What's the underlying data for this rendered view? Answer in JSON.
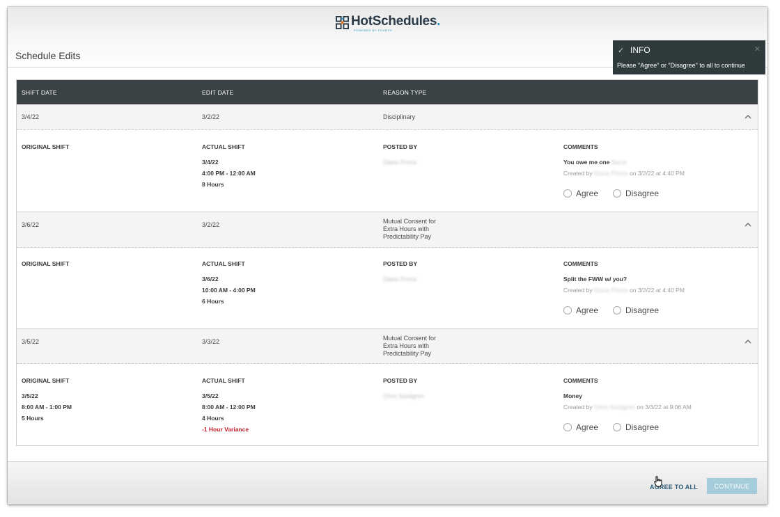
{
  "app": {
    "logo_text": "HotSchedules",
    "logo_dot": ".",
    "logo_sub": "POWERED BY FOURTH",
    "page_title": "Schedule Edits"
  },
  "toast": {
    "title": "INFO",
    "message": "Please \"Agree\" or \"Disagree\" to all to continue"
  },
  "table": {
    "headers": [
      "SHIFT DATE",
      "EDIT DATE",
      "REASON TYPE"
    ],
    "detail_labels": {
      "original": "ORIGINAL SHIFT",
      "actual": "ACTUAL SHIFT",
      "posted": "POSTED BY",
      "comments": "COMMENTS"
    },
    "radio_labels": {
      "agree": "Agree",
      "disagree": "Disagree"
    },
    "edits": [
      {
        "shift_date": "3/4/22",
        "edit_date": "3/2/22",
        "reason": [
          "Disciplinary"
        ],
        "original": [],
        "actual": [
          "3/4/22",
          "4:00 PM - 12:00 AM",
          "8 Hours"
        ],
        "variance": "",
        "posted_by": "Diana Prince",
        "comment": "You owe me one",
        "comment_blur": "Barryl",
        "created_prefix": "Created by",
        "created_name": "Diana Prince",
        "created_suffix": "on 3/2/22 at 4:40 PM"
      },
      {
        "shift_date": "3/6/22",
        "edit_date": "3/2/22",
        "reason": [
          "Mutual Consent for",
          "Extra Hours with",
          "Predictability Pay"
        ],
        "original": [],
        "actual": [
          "3/6/22",
          "10:00 AM - 4:00 PM",
          "6 Hours"
        ],
        "variance": "",
        "posted_by": "Diana Prince",
        "comment": "Split the FWW w/ you?",
        "comment_blur": "",
        "created_prefix": "Created by",
        "created_name": "Diana Prince",
        "created_suffix": "on 3/2/22 at 4:40 PM"
      },
      {
        "shift_date": "3/5/22",
        "edit_date": "3/3/22",
        "reason": [
          "Mutual Consent for",
          "Extra Hours with",
          "Predictability Pay"
        ],
        "original": [
          "3/5/22",
          "8:00 AM - 1:00 PM",
          "5 Hours"
        ],
        "actual": [
          "3/5/22",
          "8:00 AM - 12:00 PM",
          "4 Hours"
        ],
        "variance": "-1 Hour Variance",
        "posted_by": "Chris Sundgren",
        "comment": "Money",
        "comment_blur": "",
        "created_prefix": "Created by",
        "created_name": "Chris Sundgren",
        "created_suffix": "on 3/3/22 at 9:06 AM"
      }
    ]
  },
  "footer": {
    "agree_all": "AGREE TO ALL",
    "continue": "CONTINUE"
  },
  "colors": {
    "header_bg": "#3a4245",
    "toast_bg": "#2f3a3d",
    "variance": "#c0202a",
    "continue_bg": "#a4ccda",
    "link": "#2a5a76"
  },
  "icons": [
    "logo-icon",
    "check-icon",
    "close-icon",
    "chevron-up-icon",
    "cursor-hand-icon"
  ]
}
